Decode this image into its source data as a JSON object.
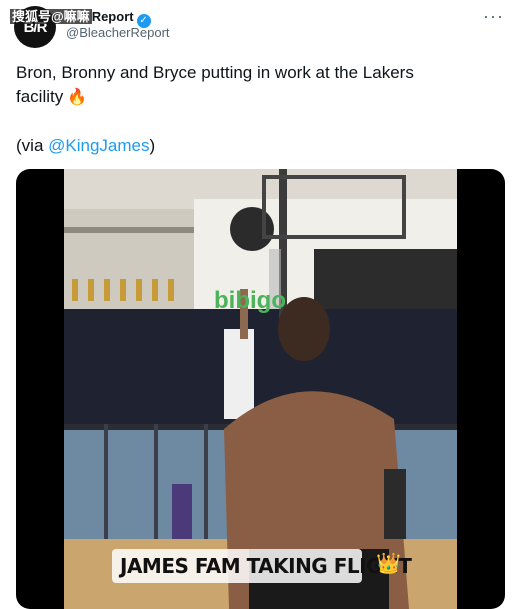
{
  "header": {
    "watermark": "搜狐号@嘛嘛",
    "display_name": "Report",
    "verified_icon": "verified-badge-icon",
    "handle": "@BleacherReport",
    "avatar_text": "B/R",
    "more_icon": "more-options-icon"
  },
  "tweet": {
    "line1": "Bron, Bronny and Bryce putting in work at the Lakers",
    "line2": "facility",
    "fire_icon": "fire-icon",
    "via_prefix": "(via ",
    "via_mention": "@KingJames",
    "via_suffix": ")"
  },
  "media": {
    "caption": "JAMES FAM TAKING FLIGHT",
    "crown_icon": "crown-icon",
    "wall_sign": "bibigo"
  },
  "colors": {
    "link": "#1d9bf0",
    "secondary_text": "#536471",
    "video_background": "#000000"
  }
}
